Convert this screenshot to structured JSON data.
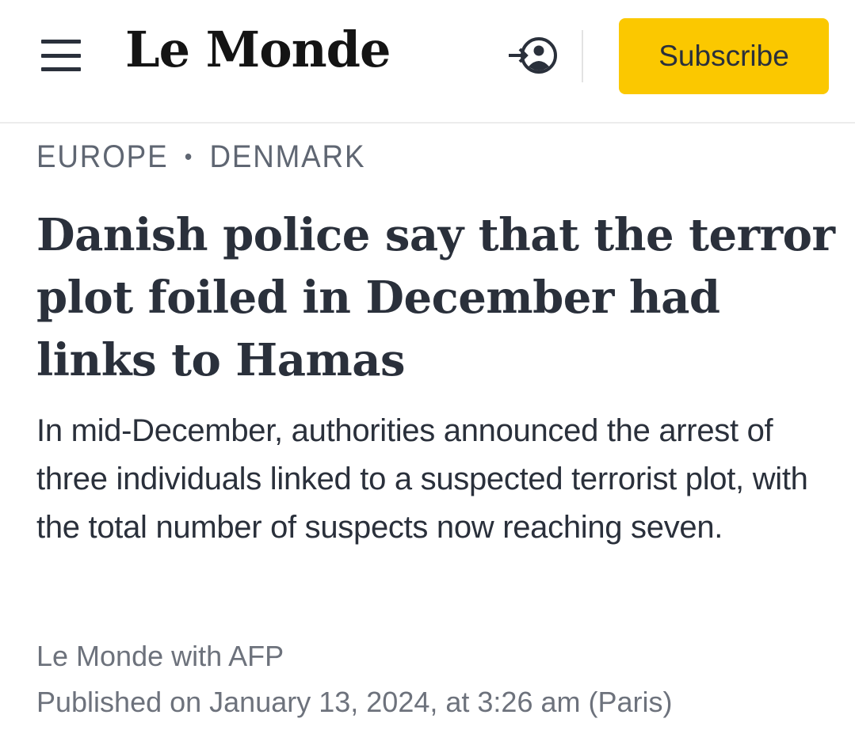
{
  "header": {
    "logo_text": "Le Monde",
    "menu_icon": "hamburger-menu-icon",
    "login_icon": "login-user-icon",
    "subscribe_label": "Subscribe",
    "accent_color": "#fbc800"
  },
  "breadcrumb": {
    "section": "EUROPE",
    "separator": "•",
    "subsection": "DENMARK"
  },
  "article": {
    "headline": "Danish police say that the terror plot foiled in December had links to Hamas",
    "standfirst": "In mid-December, authorities announced the arrest of three individuals linked to a suspected terrorist plot, with the total number of suspects now reaching seven.",
    "byline": "Le Monde with AFP",
    "published": "Published on January 13, 2024, at 3:26 am (Paris)"
  }
}
